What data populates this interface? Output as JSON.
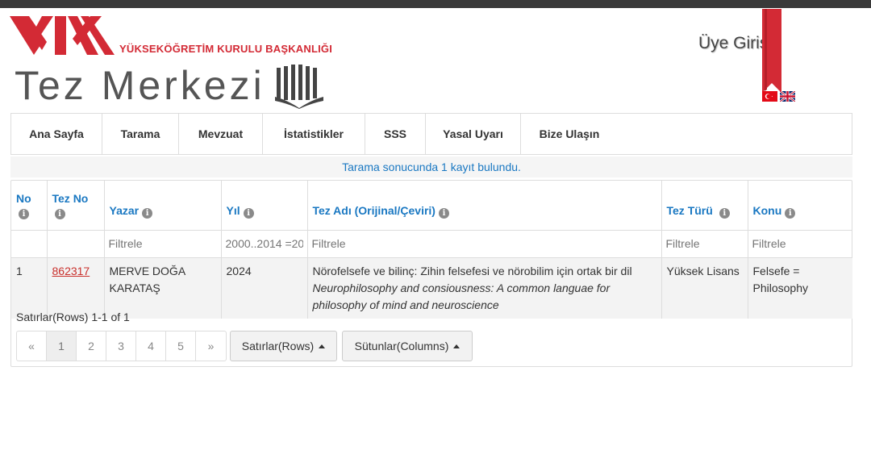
{
  "header": {
    "org_name": "YÜKSEKÖĞRETİM KURULU BAŞKANLIĞI",
    "site_title": "Tez Merkezi",
    "member_login": "Üye Girişi",
    "brand_red": "#d32a35"
  },
  "nav": {
    "items": [
      {
        "label": "Ana Sayfa"
      },
      {
        "label": "Tarama"
      },
      {
        "label": "Mevzuat"
      },
      {
        "label": "İstatistikler"
      },
      {
        "label": "SSS"
      },
      {
        "label": "Yasal Uyarı"
      },
      {
        "label": "Bize Ulaşın"
      }
    ]
  },
  "result_banner": "Tarama sonucunda 1 kayıt bulundu.",
  "table": {
    "headers": {
      "no": "No",
      "thesis_no": "Tez No",
      "author": "Yazar",
      "year": "Yıl",
      "title": "Tez Adı (Orijinal/Çeviri)",
      "type": "Tez Türü",
      "subject": "Konu"
    },
    "info_glyph": "i",
    "filters": {
      "author": "Filtrele",
      "year": "2000..2014 =20",
      "title": "Filtrele",
      "type": "Filtrele",
      "subject": "Filtrele"
    },
    "rows": [
      {
        "no": "1",
        "thesis_no": "862317",
        "author": "MERVE DOĞA KARATAŞ",
        "year": "2024",
        "title_original": "Nörofelsefe ve bilinç: Zihin felsefesi ve nörobilim için ortak bir dil",
        "title_translated": "Neurophilosophy and consiousness: A common languae for philosophy of mind and neuroscience",
        "type": "Yüksek Lisans",
        "subject": "Felsefe = Philosophy"
      }
    ]
  },
  "pagination": {
    "rows_info": "Satırlar(Rows) 1-1 of 1",
    "prev": "«",
    "pages": [
      "1",
      "2",
      "3",
      "4",
      "5"
    ],
    "next": "»",
    "current_page": "1",
    "rows_button": "Satırlar(Rows)",
    "columns_button": "Sütunlar(Columns)"
  }
}
